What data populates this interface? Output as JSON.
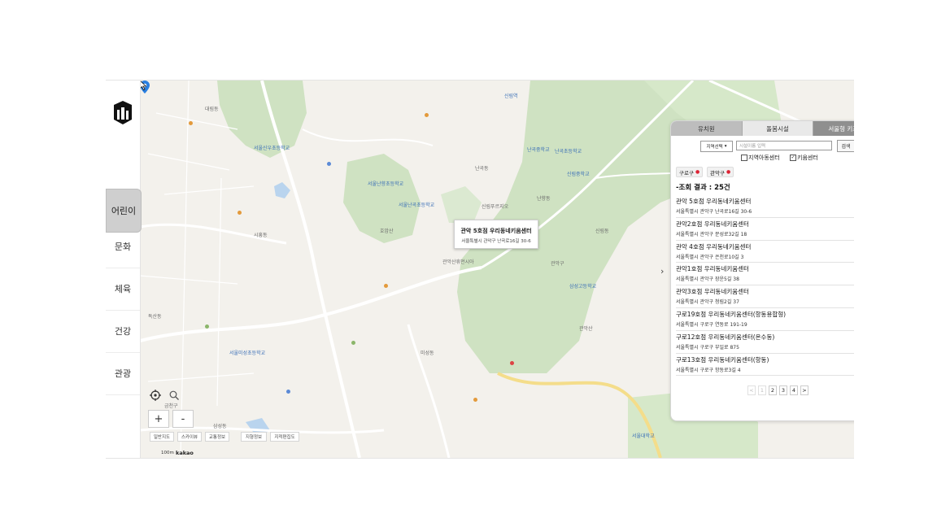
{
  "nav": {
    "items": [
      "어린이",
      "문화",
      "체육",
      "건강",
      "관광"
    ],
    "active_index": 0
  },
  "panel": {
    "tabs": [
      "유치원",
      "돌봄시설",
      "서울형 키즈카페"
    ],
    "active_tab": 1,
    "region_select": "지역선택",
    "search_placeholder": "시설이름 입력",
    "search_button": "검색",
    "checkboxes": [
      {
        "label": "지역아동센터",
        "checked": false
      },
      {
        "label": "키움센터",
        "checked": true
      }
    ],
    "filter_tags": [
      "구로구",
      "관악구"
    ],
    "result_title": "-조회 결과 : 25건",
    "results": [
      {
        "name": "관악 5호점 우리동네키움센터",
        "address": "서울특별시 관악구 난곡로16길 30-6"
      },
      {
        "name": "관악2호점 우리동네키움센터",
        "address": "서울특별시 관악구 문성로32길 18"
      },
      {
        "name": "관악 4호점 우리동네키움센터",
        "address": "서울특별시 관악구 은천로10길 3"
      },
      {
        "name": "관악1호점 우리동네키움센터",
        "address": "서울특별시 관악구 장운5길 38"
      },
      {
        "name": "관악3호점 우리동네키움센터",
        "address": "서울특별시 관악구 청림2길 37"
      },
      {
        "name": "구로19호점 우리동네키움센터(항동용합형)",
        "address": "서울특별시 구로구 연동로 191-19"
      },
      {
        "name": "구로12호점 우리동네키움센터(온수동)",
        "address": "서울특별시 구로구 부일로 875"
      },
      {
        "name": "구로13호점 우리동네키움센터(항동)",
        "address": "서울특별시 구로구 항동로3길 4"
      }
    ],
    "pagination": {
      "prev": "<",
      "pages": [
        "1",
        "2",
        "3",
        "4"
      ],
      "next": ">",
      "current": "1"
    }
  },
  "map": {
    "tooltip_name": "관악 5호점 우리동네키움센터",
    "tooltip_address": "서울특별시 관악구 난곡로16길 30-6",
    "zoom_in": "+",
    "zoom_out": "-",
    "tools": [
      "일반지도",
      "스카이뷰",
      "교통정보",
      "지형정보",
      "지적편집도"
    ],
    "scale_label": "100m",
    "provider": "kakao",
    "labels": [
      {
        "text": "금천구",
        "c": "gray"
      },
      {
        "text": "관악구",
        "c": "gray"
      },
      {
        "text": "난곡동",
        "c": "gray"
      },
      {
        "text": "난곡초등학교",
        "c": "blue"
      },
      {
        "text": "난곡중학교",
        "c": "blue"
      },
      {
        "text": "신림중학교",
        "c": "blue"
      },
      {
        "text": "서울신우초등학교",
        "c": "blue"
      },
      {
        "text": "서울난향초등학교",
        "c": "blue"
      },
      {
        "text": "삼성고등학교",
        "c": "blue"
      },
      {
        "text": "서울미성초등학교",
        "c": "blue"
      },
      {
        "text": "서울난곡초등학교",
        "c": "blue"
      },
      {
        "text": "관악산휴먼시아",
        "c": "gray"
      },
      {
        "text": "신림푸르지오",
        "c": "gray"
      },
      {
        "text": "난향동",
        "c": "gray"
      },
      {
        "text": "신림동",
        "c": "gray"
      },
      {
        "text": "독산동",
        "c": "gray"
      },
      {
        "text": "시흥동",
        "c": "gray"
      },
      {
        "text": "삼성동",
        "c": "gray"
      },
      {
        "text": "대림동",
        "c": "gray"
      },
      {
        "text": "관악산",
        "c": "gray"
      },
      {
        "text": "호암산",
        "c": "gray"
      },
      {
        "text": "서울대학교",
        "c": "blue"
      },
      {
        "text": "미성동",
        "c": "gray"
      },
      {
        "text": "신림역",
        "c": "blue"
      }
    ]
  }
}
